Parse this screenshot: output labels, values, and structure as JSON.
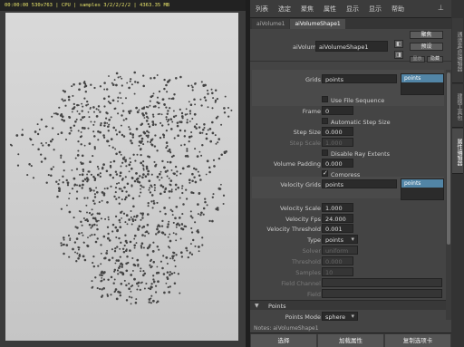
{
  "viewport": {
    "hud": "00:00:00 530x763 | CPU | samples 3/2/2/2/2 | 4363.35 MB",
    "chart_data": {
      "type": "scatter",
      "seed": 7
    }
  },
  "menubar": {
    "items": [
      "列表",
      "选定",
      "聚焦",
      "属性",
      "显示",
      "显示",
      "帮助"
    ],
    "pin_icon": "pin-icon"
  },
  "tabs": [
    "aiVolume1",
    "aiVolumeShape1"
  ],
  "node": {
    "label": "aiVolume:",
    "value": "aiVolumeShape1",
    "btn_a": "◧",
    "btn_b": "◨",
    "focus_btn": "聚焦",
    "preset_btn": "预设",
    "show_btn": "显示",
    "hide_btn": "隐藏"
  },
  "attrs": {
    "grids_label": "Grids",
    "grids_value": "points",
    "grids_list": [
      "points"
    ],
    "use_file_sequence": "Use File Sequence",
    "frame_label": "Frame",
    "frame_value": "0",
    "auto_step": "Automatic Step Size",
    "step_size_label": "Step Size",
    "step_size_value": "0.000",
    "step_scale_label": "Step Scale",
    "step_scale_value": "1.000",
    "disable_ray": "Disable Ray Extents",
    "volume_padding_label": "Volume Padding",
    "volume_padding_value": "0.000",
    "compress": "Compress",
    "velocity_grids_label": "Velocity Grids",
    "velocity_grids_value": "points",
    "velocity_grids_list": [
      "points"
    ],
    "velocity_scale_label": "Velocity Scale",
    "velocity_scale_value": "1.000",
    "velocity_fps_label": "Velocity Fps",
    "velocity_fps_value": "24.000",
    "velocity_threshold_label": "Velocity Threshold",
    "velocity_threshold_value": "0.001",
    "type_label": "Type",
    "type_value": "points",
    "solver_label": "Solver",
    "solver_value": "uniform",
    "threshold_label": "Threshold",
    "threshold_value": "0.000",
    "samples_label": "Samples",
    "samples_value": "10",
    "field_channel_label": "Field Channel",
    "field_label": "Field"
  },
  "points_section": {
    "title": "Points",
    "mode_label": "Points Mode",
    "mode_value": "sphere",
    "notes_label": "Notes: aiVolumeShape1"
  },
  "bottom": [
    "选择",
    "加载属性",
    "复制选项卡"
  ],
  "vtabs": [
    "通道盒/层编辑器",
    "建模工具包",
    "属性编辑器"
  ]
}
